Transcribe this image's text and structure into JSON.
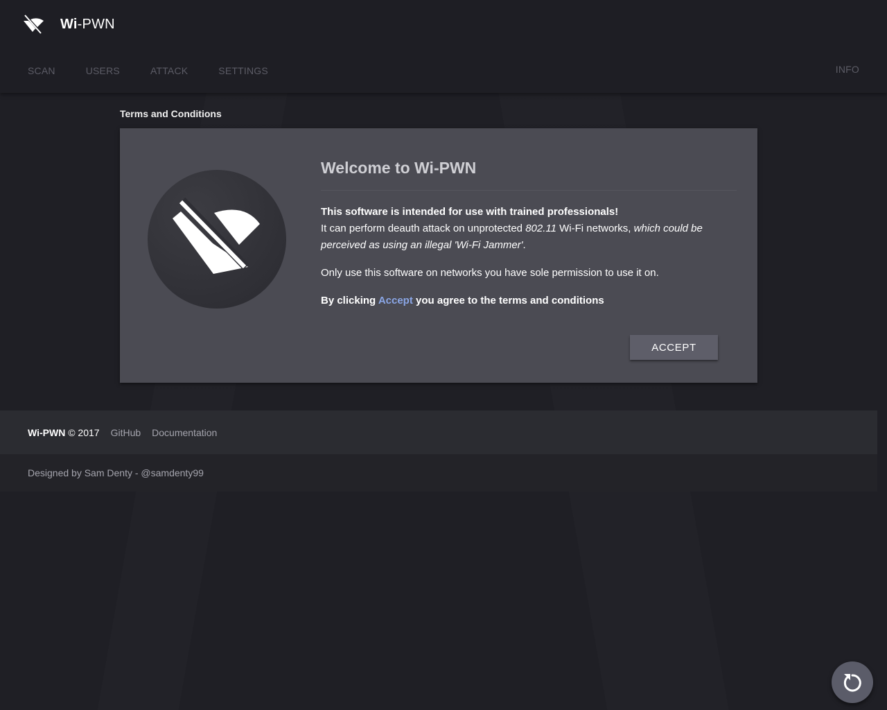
{
  "header": {
    "brand_bold": "Wi",
    "brand_rest": "-PWN",
    "logo_icon": "wifi-off-icon",
    "nav": [
      {
        "label": "SCAN"
      },
      {
        "label": "USERS"
      },
      {
        "label": "ATTACK"
      },
      {
        "label": "SETTINGS"
      }
    ],
    "info_label": "INFO"
  },
  "main": {
    "section_title": "Terms and Conditions",
    "card": {
      "hero_icon": "wifi-off-icon",
      "title": "Welcome to Wi-PWN",
      "p1_bold": "This software is intended for use with trained professionals!",
      "p1_text_a": "It can perform deauth attack on unprotected ",
      "p1_em_a": "802.11",
      "p1_text_b": " Wi-Fi networks, ",
      "p1_em_b": "which could be perceived as using an illegal 'Wi-Fi Jammer'",
      "p1_text_c": ".",
      "p2": "Only use this software on networks you have sole permission to use it on.",
      "p3_a": "By clicking ",
      "p3_accent": "Accept",
      "p3_b": " you agree to the terms and conditions",
      "accept_label": "ACCEPT"
    }
  },
  "footer": {
    "brand": "Wi-PWN",
    "copyright": " © 2017",
    "links": [
      {
        "label": "GitHub"
      },
      {
        "label": "Documentation"
      }
    ],
    "credit": "Designed by Sam Denty - @samdenty99"
  },
  "fab": {
    "icon": "refresh-icon"
  },
  "colors": {
    "background": "#1f1f25",
    "card": "#4b4b53",
    "accent_link": "#8aa6e6",
    "button": "#5e5e69",
    "nav_text": "#5c5c66"
  }
}
